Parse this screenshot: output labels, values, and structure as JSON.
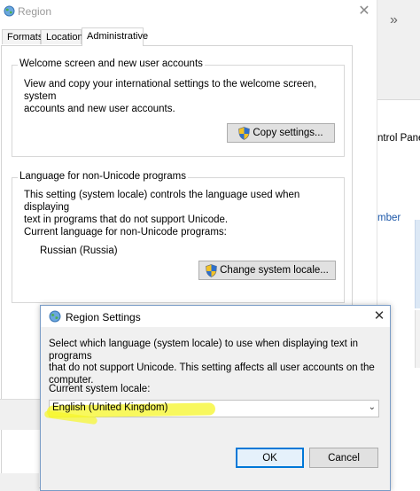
{
  "region_window": {
    "title": "Region",
    "tabs": [
      {
        "label": "Formats"
      },
      {
        "label": "Location"
      },
      {
        "label": "Administrative"
      }
    ],
    "welcome_group": {
      "title": "Welcome screen and new user accounts",
      "description_line1": "View and copy your international settings to the welcome screen, system",
      "description_line2": "accounts and new user accounts.",
      "button_label": "Copy settings..."
    },
    "non_unicode_group": {
      "title": "Language for non-Unicode programs",
      "description_line1": "This setting (system locale) controls the language used when displaying",
      "description_line2": "text in programs that do not support Unicode.",
      "current_label": "Current language for non-Unicode programs:",
      "current_value": "Russian (Russia)",
      "button_label": "Change system locale..."
    }
  },
  "background_window": {
    "chevron": "»",
    "control_panel_text": "ntrol Pane",
    "link_text": "mber"
  },
  "dialog": {
    "title": "Region Settings",
    "description_line1": "Select which language (system locale) to use when displaying text in programs",
    "description_line2": "that do not support Unicode. This setting affects all user accounts on the",
    "description_line3": "computer.",
    "locale_label": "Current system locale:",
    "locale_value": "English (United Kingdom)",
    "ok_label": "OK",
    "cancel_label": "Cancel"
  },
  "colors": {
    "highlight": "#f6f628",
    "button_face": "#e1e1e1",
    "dialog_border": "#7a9cc6",
    "ok_border": "#0078d7"
  },
  "icons": [
    "globe-icon",
    "close-icon",
    "shield-icon",
    "chevron-down-icon",
    "double-chevron-icon"
  ]
}
